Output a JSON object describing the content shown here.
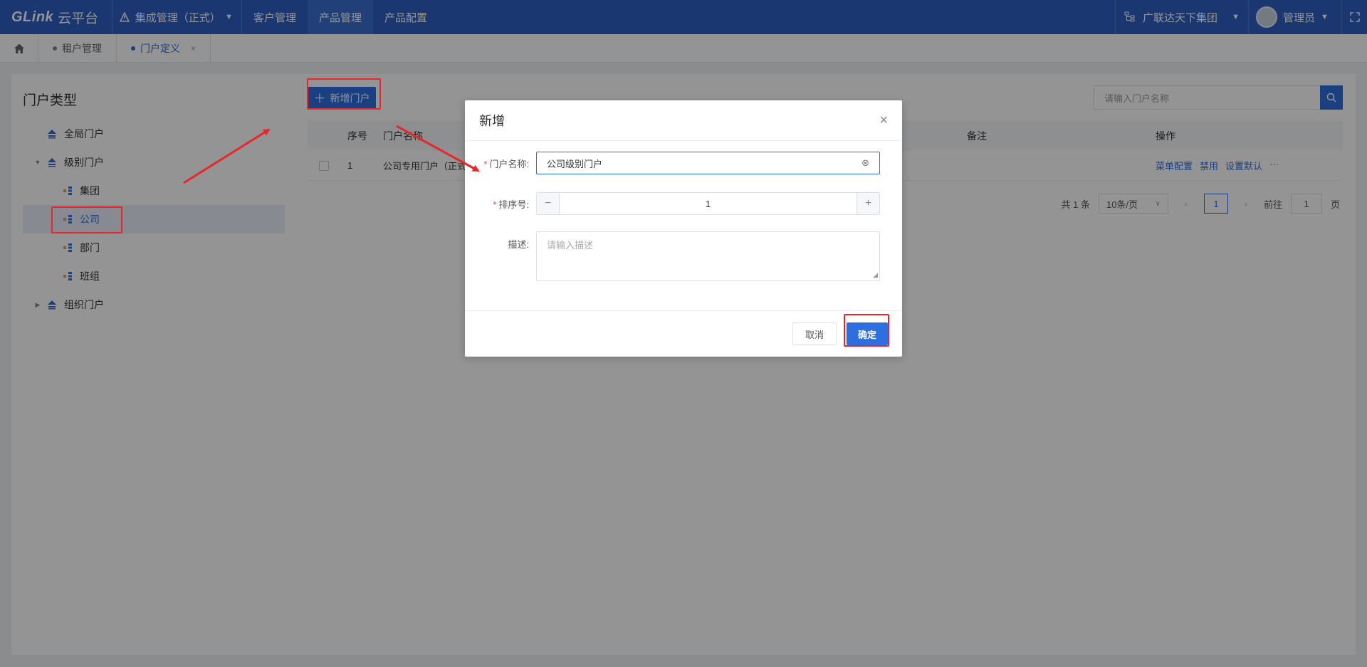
{
  "app": {
    "brand": "GLink",
    "brand_suffix": "云平台",
    "environment": "集成管理（正式）",
    "nav": [
      {
        "label": "客户管理"
      },
      {
        "label": "产品管理"
      },
      {
        "label": "产品配置"
      }
    ],
    "org_name": "广联达天下集团",
    "user_name": "管理员",
    "colors": {
      "header": "#2d5fc4",
      "accent": "#2d6fe0",
      "annotation": "#e8272b"
    }
  },
  "tabs": [
    {
      "label": "租户管理"
    },
    {
      "label": "门户定义",
      "close": "×"
    }
  ],
  "left_panel": {
    "title": "门户类型",
    "tree": [
      {
        "label": "全局门户"
      },
      {
        "label": "级别门户"
      },
      {
        "label": "集团"
      },
      {
        "label": "公司"
      },
      {
        "label": "部门"
      },
      {
        "label": "班组"
      },
      {
        "label": "组织门户"
      }
    ]
  },
  "main": {
    "add_button": "新增门户",
    "search_placeholder": "请输入门户名称",
    "columns": {
      "index": "序号",
      "name": "门户名称",
      "remark": "备注",
      "ops": "操作"
    },
    "rows": [
      {
        "index": "1",
        "name": "公司专用门户（正式）",
        "remark": "",
        "ops": [
          "菜单配置",
          "禁用",
          "设置默认",
          "···"
        ]
      }
    ],
    "pager": {
      "total": "共 1 条",
      "page_size": "10条/页",
      "current": "1",
      "goto_prefix": "前往",
      "goto_value": "1",
      "goto_suffix": "页"
    }
  },
  "modal": {
    "title": "新增",
    "close": "×",
    "name_label": "门户名称:",
    "name_value": "公司级别门户",
    "order_label": "排序号:",
    "order_value": "1",
    "desc_label": "描述:",
    "desc_placeholder": "请输入描述",
    "cancel": "取消",
    "ok": "确定"
  }
}
